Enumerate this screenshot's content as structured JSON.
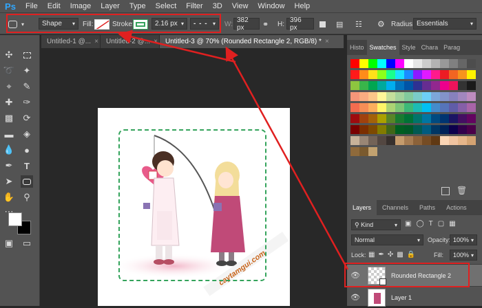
{
  "app": {
    "logo": "Ps"
  },
  "menu": [
    "File",
    "Edit",
    "Image",
    "Layer",
    "Type",
    "Select",
    "Filter",
    "3D",
    "View",
    "Window",
    "Help"
  ],
  "options": {
    "mode": "Shape",
    "fill_label": "Fill:",
    "stroke_label": "Stroke:",
    "stroke_width": "2.16 px",
    "stroke_color": "#33a35b",
    "w_label": "W:",
    "w_value": "382 px",
    "h_label": "H:",
    "h_value": "396 px",
    "radius_label": "Radius:",
    "workspace": "Essentials"
  },
  "tabs": [
    {
      "label": "Untitled-1 @..."
    },
    {
      "label": "Untitled-2 @..."
    },
    {
      "label": "Untitled-3 @ 70% (Rounded Rectangle 2, RGB/8) *"
    }
  ],
  "panel_tabs_top": [
    "Histo",
    "Swatches",
    "Style",
    "Chara",
    "Parag"
  ],
  "panel_tabs_layers": [
    "Layers",
    "Channels",
    "Paths",
    "Actions"
  ],
  "layers_panel": {
    "filter_kind": "Kind",
    "blend_mode": "Normal",
    "opacity_label": "Opacity:",
    "opacity_value": "100%",
    "lock_label": "Lock:",
    "fill_label": "Fill:",
    "fill_value": "100%",
    "layers": [
      {
        "name": "Rounded Rectangle 2",
        "selected": true
      },
      {
        "name": "Layer 1",
        "selected": false
      }
    ]
  },
  "watermark": "caytamgui.com",
  "accent": {
    "annotation_red": "#e02020",
    "dash_green": "#33a35b"
  }
}
